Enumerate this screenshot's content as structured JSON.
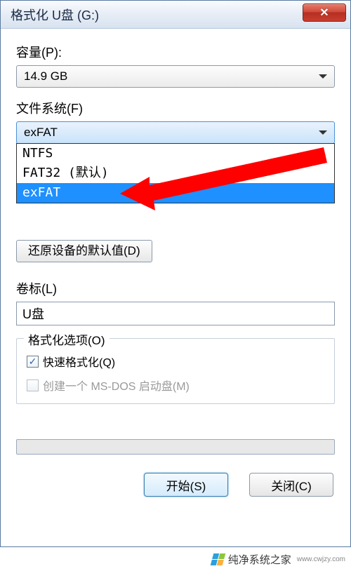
{
  "window": {
    "title": "格式化 U盘 (G:)"
  },
  "capacity": {
    "label": "容量(P):",
    "value": "14.9 GB"
  },
  "filesystem": {
    "label": "文件系统(F)",
    "value": "exFAT",
    "options": [
      {
        "label": "NTFS",
        "selected": false
      },
      {
        "label": "FAT32 (默认)",
        "selected": false
      },
      {
        "label": "exFAT",
        "selected": true
      }
    ]
  },
  "restore_defaults_label": "还原设备的默认值(D)",
  "volume": {
    "label": "卷标(L)",
    "value": "U盘"
  },
  "options_group": {
    "title": "格式化选项(O)",
    "quick_format": {
      "label": "快速格式化(Q)",
      "checked": true
    },
    "msdos_boot": {
      "label": "创建一个 MS-DOS 启动盘(M)",
      "checked": false,
      "enabled": false
    }
  },
  "buttons": {
    "start": "开始(S)",
    "close": "关闭(C)"
  },
  "watermark": {
    "text": "纯净系统之家",
    "url": "www.cwjzy.com"
  }
}
